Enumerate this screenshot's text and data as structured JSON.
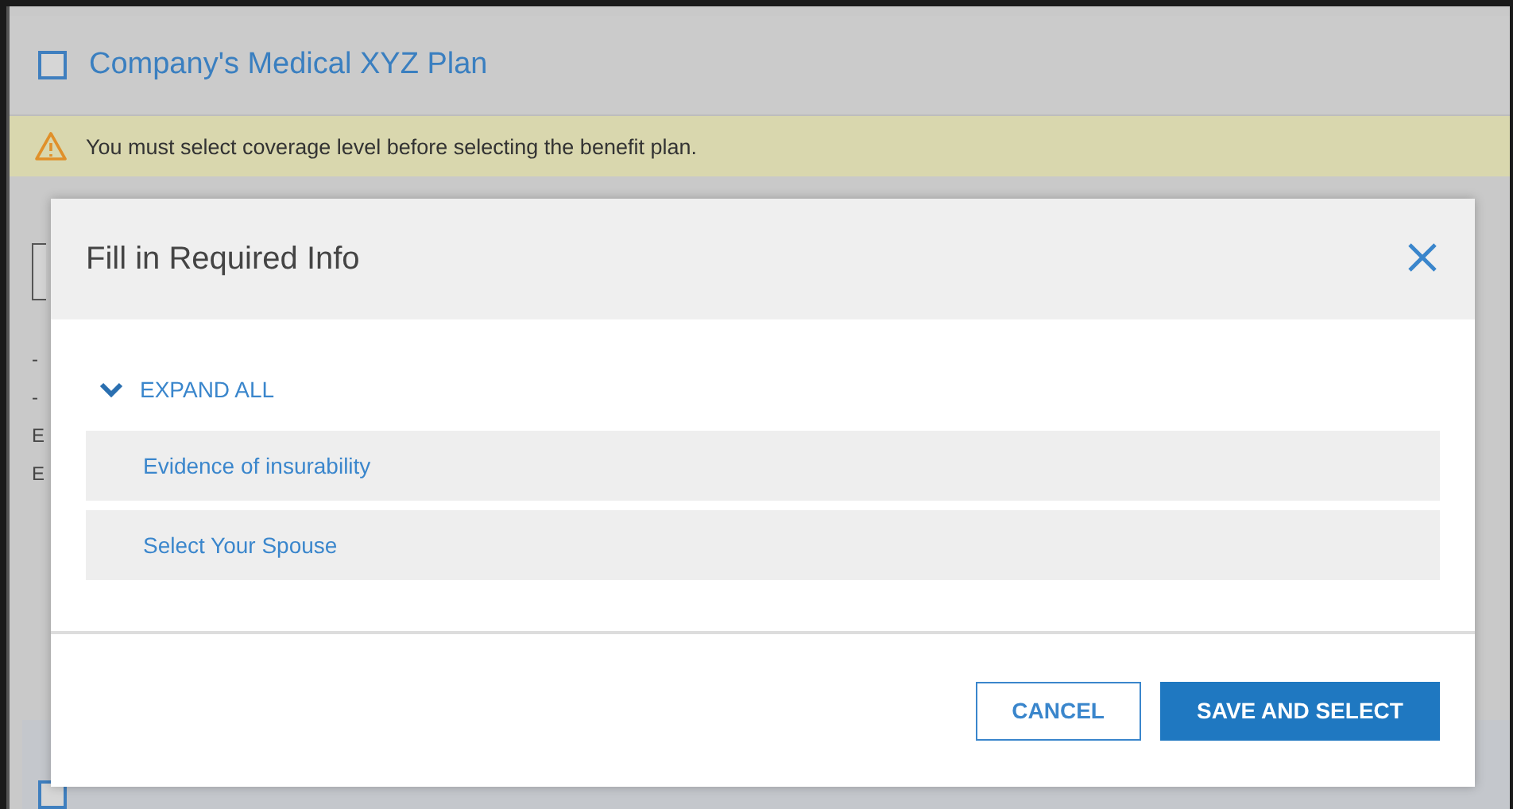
{
  "plan": {
    "title": "Company's Medical XYZ Plan",
    "checked": false
  },
  "warning": {
    "text": "You must select coverage level before selecting the benefit plan."
  },
  "background_fragments": [
    {
      "kind": "field"
    },
    {
      "kind": "value",
      "text": "-"
    },
    {
      "kind": "value",
      "text": "-"
    },
    {
      "kind": "label",
      "text": "E"
    },
    {
      "kind": "value",
      "text": "E"
    }
  ],
  "next_plan": {
    "checked": false
  },
  "dialog": {
    "title": "Fill in Required Info",
    "expand_all": "EXPAND ALL",
    "sections": [
      {
        "label": "Evidence of insurability"
      },
      {
        "label": "Select Your Spouse"
      }
    ],
    "buttons": [
      {
        "kind": "secondary",
        "label": "CANCEL"
      },
      {
        "kind": "primary",
        "label": "SAVE AND SELECT"
      }
    ]
  }
}
